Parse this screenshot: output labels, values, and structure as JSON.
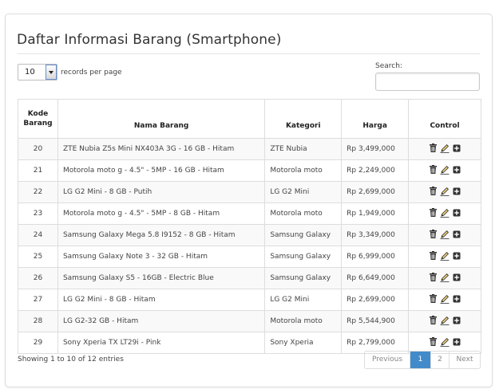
{
  "page": {
    "title": "Daftar Informasi Barang (Smartphone)"
  },
  "length_menu": {
    "value": "10",
    "label": "records per page"
  },
  "search": {
    "label": "Search:",
    "value": ""
  },
  "table": {
    "headers": {
      "kode_line1": "Kode",
      "kode_line2": "Barang",
      "nama": "Nama Barang",
      "kategori": "Kategori",
      "harga": "Harga",
      "control": "Control"
    },
    "rows": [
      {
        "kode": "20",
        "nama": "ZTE Nubia Z5s Mini NX403A 3G - 16 GB - Hitam",
        "kategori": "ZTE Nubia",
        "harga": "Rp 3,499,000"
      },
      {
        "kode": "21",
        "nama": "Motorola moto g - 4.5\" - 5MP - 16 GB - Hitam",
        "kategori": "Motorola moto",
        "harga": "Rp 2,249,000"
      },
      {
        "kode": "22",
        "nama": "LG G2 Mini - 8 GB - Putih",
        "kategori": "LG G2 Mini",
        "harga": "Rp 2,699,000"
      },
      {
        "kode": "23",
        "nama": "Motorola moto g - 4.5\" - 5MP - 8 GB - Hitam",
        "kategori": "Motorola moto",
        "harga": "Rp 1,949,000"
      },
      {
        "kode": "24",
        "nama": "Samsung Galaxy Mega 5.8 I9152 - 8 GB - Hitam",
        "kategori": "Samsung Galaxy",
        "harga": "Rp 3,349,000"
      },
      {
        "kode": "25",
        "nama": "Samsung Galaxy Note 3 - 32 GB - Hitam",
        "kategori": "Samsung Galaxy",
        "harga": "Rp 6,999,000"
      },
      {
        "kode": "26",
        "nama": "Samsung Galaxy S5 - 16GB - Electric Blue",
        "kategori": "Samsung Galaxy",
        "harga": "Rp 6,649,000"
      },
      {
        "kode": "27",
        "nama": "LG G2 Mini - 8 GB - Hitam",
        "kategori": "LG G2 Mini",
        "harga": "Rp 2,699,000"
      },
      {
        "kode": "28",
        "nama": "LG G2-32 GB - Hitam",
        "kategori": "Motorola moto",
        "harga": "Rp 5,544,900"
      },
      {
        "kode": "29",
        "nama": "Sony Xperia TX LT29i - Pink",
        "kategori": "Sony Xperia",
        "harga": "Rp 2,799,000"
      }
    ],
    "control_icons": [
      "trash-icon",
      "pencil-icon",
      "plus-icon"
    ]
  },
  "footer": {
    "info": "Showing 1 to 10 of 12 entries",
    "pagination": {
      "previous": "Previous",
      "page1": "1",
      "page2": "2",
      "next": "Next"
    }
  },
  "colors": {
    "active_page": "#428bca",
    "striped_row": "#f9f9f9"
  }
}
